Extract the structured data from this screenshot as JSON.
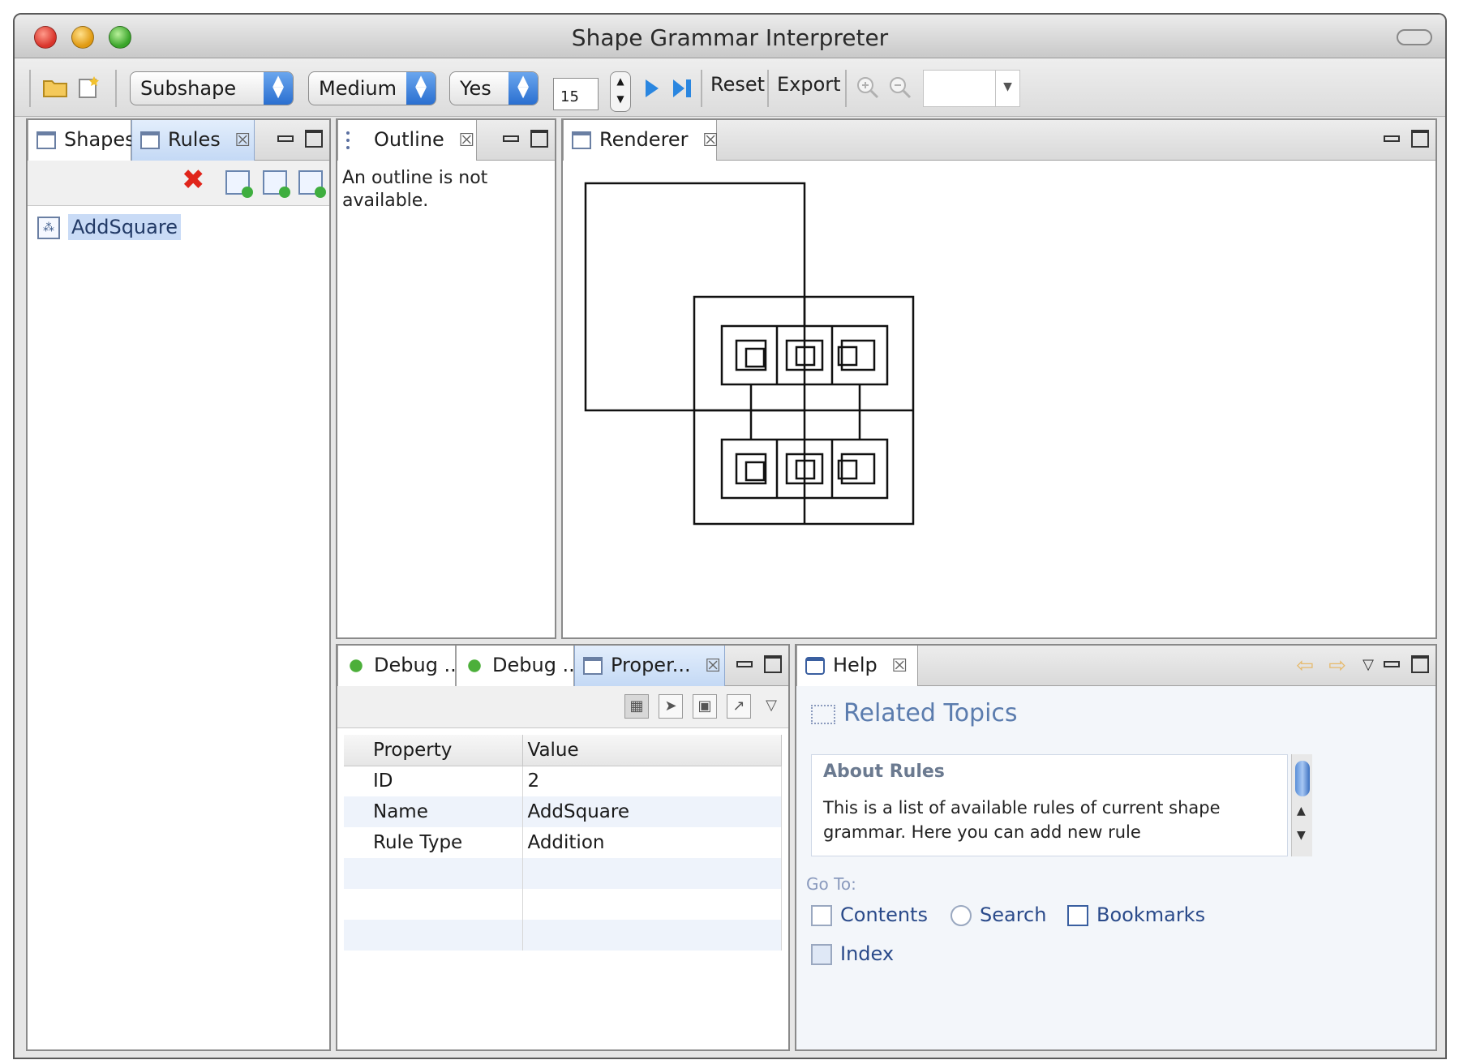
{
  "window": {
    "title": "Shape Grammar Interpreter"
  },
  "toolbar": {
    "open_icon": "folder-open-icon",
    "new_icon": "new-file-icon",
    "select_mode": "Subshape",
    "select_speed": "Medium",
    "select_yes": "Yes",
    "steps_value": "15",
    "play_icon": "play-icon",
    "step_end_icon": "step-to-end-icon",
    "reset_label": "Reset",
    "export_label": "Export",
    "zoom_in_icon": "zoom-in-icon",
    "zoom_out_icon": "zoom-out-icon",
    "zoom_value": ""
  },
  "left_panel": {
    "tabs": [
      {
        "label": "Shapes"
      },
      {
        "label": "Rules"
      }
    ],
    "close_glyph": "☒",
    "tree_item": "AddSquare",
    "tree_icon": "rule-icon"
  },
  "outline_panel": {
    "tab_label": "Outline",
    "message": "An outline is not available."
  },
  "renderer_panel": {
    "tab_label": "Renderer"
  },
  "properties_panel": {
    "tabs": [
      {
        "label": "Debug ..."
      },
      {
        "label": "Debug ..."
      },
      {
        "label": "Proper..."
      }
    ],
    "columns": [
      "Property",
      "Value"
    ],
    "rows": [
      {
        "property": "ID",
        "value": "2"
      },
      {
        "property": "Name",
        "value": "AddSquare"
      },
      {
        "property": "Rule Type",
        "value": "Addition"
      },
      {
        "property": "",
        "value": ""
      },
      {
        "property": "",
        "value": ""
      },
      {
        "property": "",
        "value": ""
      }
    ]
  },
  "help_panel": {
    "tab_label": "Help",
    "related_topics": "Related Topics",
    "about_title": "About Rules",
    "about_text": "This is a list of available rules of current shape grammar. Here you can add new rule",
    "goto_label": "Go To:",
    "links": [
      {
        "label": "Contents"
      },
      {
        "label": "Search"
      },
      {
        "label": "Bookmarks"
      },
      {
        "label": "Index"
      }
    ]
  },
  "colors": {
    "accent_blue": "#2a6fd0",
    "delete_red": "#e0251b",
    "help_link": "#2a4a8a"
  }
}
